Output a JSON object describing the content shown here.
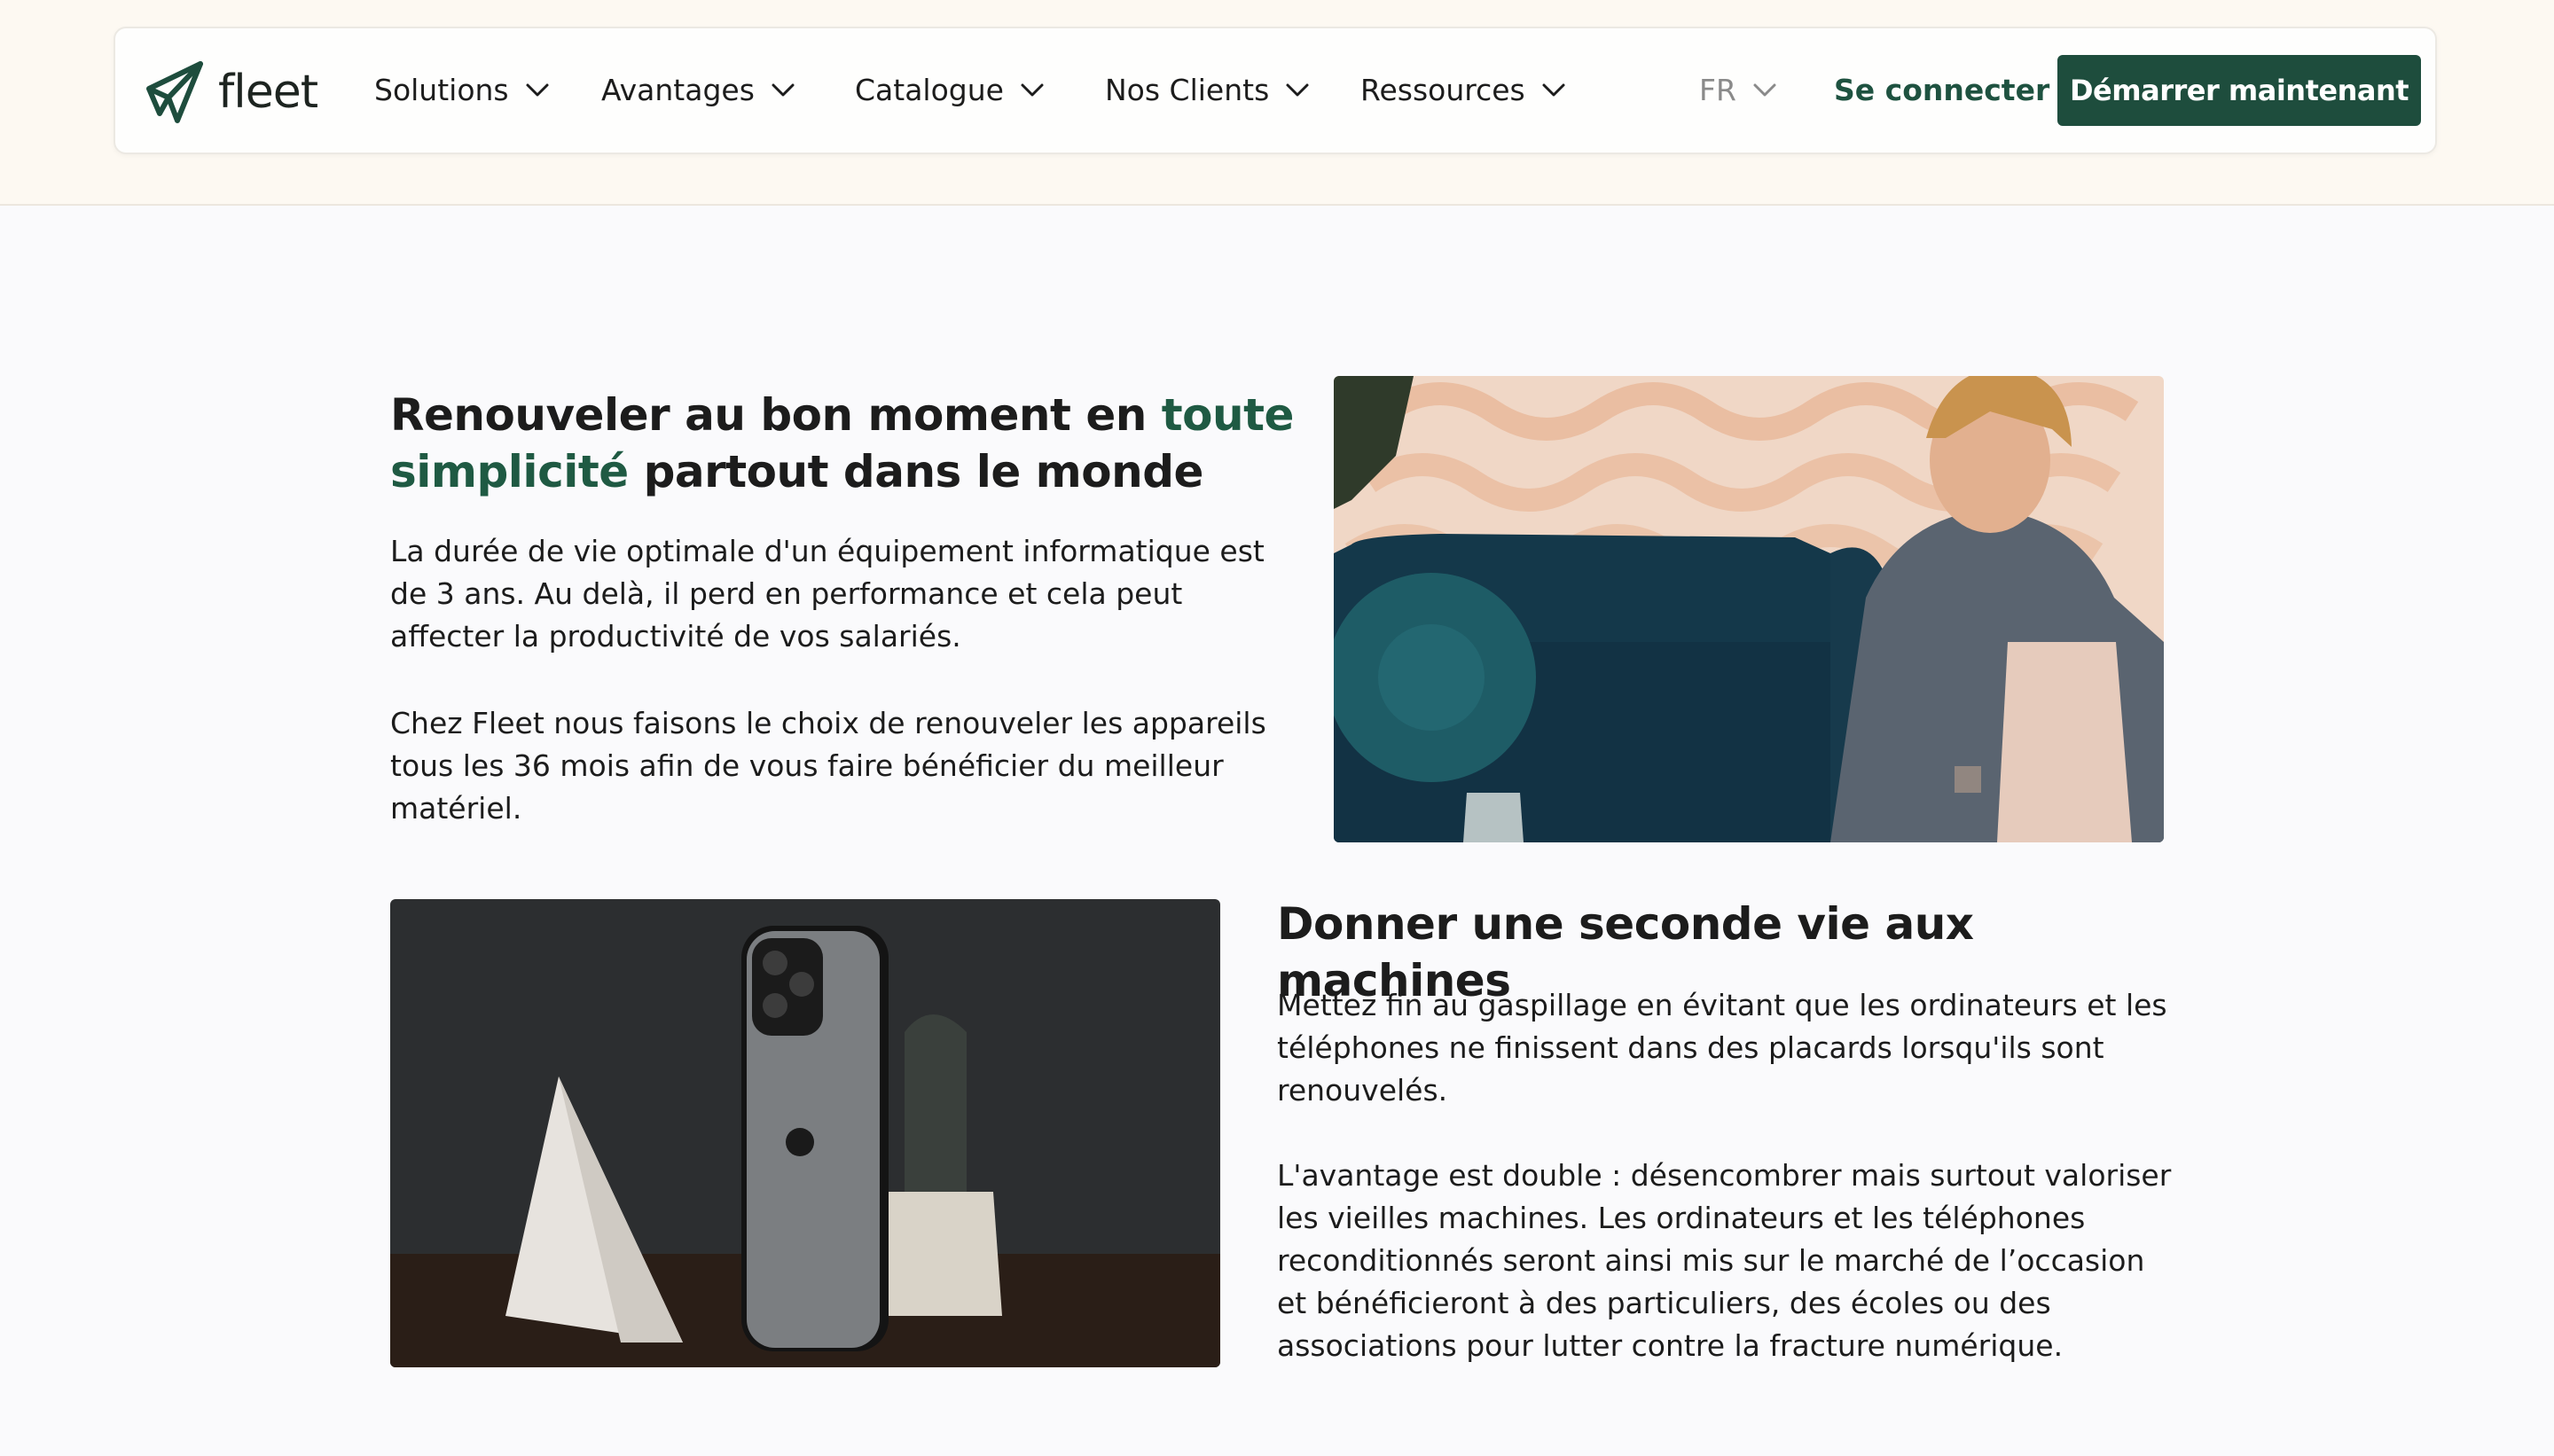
{
  "header": {
    "logo_text": "fleet",
    "nav_items": [
      {
        "label": "Solutions"
      },
      {
        "label": "Avantages"
      },
      {
        "label": "Catalogue"
      },
      {
        "label": "Nos Clients"
      },
      {
        "label": "Ressources"
      }
    ],
    "language": "FR",
    "login_label": "Se connecter",
    "cta_label": "Démarrer maintenant"
  },
  "section1": {
    "title_part1": "Renouveler au bon moment en ",
    "title_highlight": "toute simplicité",
    "title_part2": " partout dans le monde",
    "paragraph1": "La durée de vie optimale d'un équipement informatique est de 3 ans. Au delà, il perd en performance et cela peut affecter la productivité de vos salariés.",
    "paragraph2": "Chez Fleet nous faisons le choix de renouveler les appareils tous les 36 mois afin de vous faire bénéficier du meilleur matériel."
  },
  "section2": {
    "title": "Donner une seconde vie aux machines",
    "paragraph1": "Mettez fin au gaspillage en évitant que les ordinateurs et les téléphones ne finissent dans des placards lorsqu'ils sont renouvelés.",
    "paragraph2": "L'avantage est double : désencombrer mais surtout valoriser les vieilles machines. Les ordinateurs et les téléphones reconditionnés seront ainsi mis sur le marché de l’occasion et bénéficieront à des particuliers, des écoles ou des associations pour lutter contre la fracture numérique."
  },
  "colors": {
    "brand_green": "#1e4d3d",
    "accent_green": "#1f5a43",
    "header_background": "#fdf9f2"
  }
}
